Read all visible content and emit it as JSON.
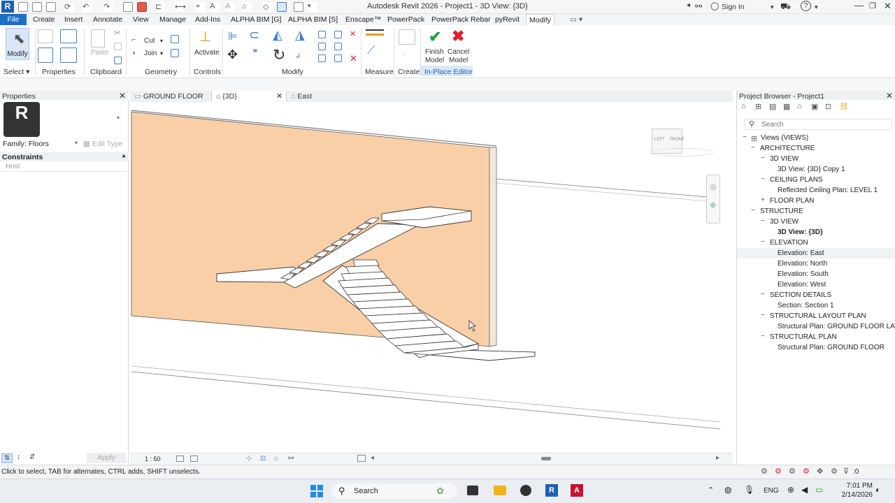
{
  "window": {
    "title": "Autodesk Revit 2026 - Project1 - 3D View: {3D}",
    "sign_in": "Sign In",
    "help": "?"
  },
  "menubar": {
    "items": [
      "File",
      "Create",
      "Insert",
      "Annotate",
      "View",
      "Manage",
      "Add-Ins",
      "ALPHA BIM [G]",
      "ALPHA BIM [S]",
      "Enscape™",
      "PowerPack",
      "PowerPack Rebar",
      "pyRevit",
      "Modify"
    ]
  },
  "ribbon": {
    "modify_label": "Modify",
    "cut_label": "Cut",
    "join_label": "Join",
    "paste_label": "Paste",
    "activate_label": "Activate",
    "finish_model": [
      "Finish",
      "Model"
    ],
    "cancel_model": [
      "Cancel",
      "Model"
    ],
    "groups": [
      "Select",
      "Properties",
      "Clipboard",
      "Geometry",
      "Controls",
      "Modify",
      "Measure",
      "Create",
      "In-Place Editor"
    ]
  },
  "properties": {
    "title": "Properties",
    "family": "Family: Floors",
    "edit_type": "Edit Type",
    "constraints": "Constraints",
    "host": "Host",
    "apply": "Apply",
    "logo_letter": "R"
  },
  "tabs": [
    "GROUND FLOOR",
    "{3D}",
    "East"
  ],
  "viewcube": {
    "left": "LEFT",
    "front": "FRONT"
  },
  "view_controls": {
    "scale": "1 : 50"
  },
  "project_browser": {
    "title": "Project Browser - Project1",
    "search_placeholder": "Search",
    "tree": [
      {
        "text": "Views (VIEWS)",
        "level": 0,
        "toggle": "−"
      },
      {
        "text": "ARCHITECTURE",
        "level": 1,
        "toggle": "−"
      },
      {
        "text": "3D VIEW",
        "level": 2,
        "toggle": "−"
      },
      {
        "text": "3D View: {3D} Copy 1",
        "level": 3,
        "toggle": ""
      },
      {
        "text": "CEILING PLANS",
        "level": 2,
        "toggle": "−"
      },
      {
        "text": "Reflected Ceiling Plan: LEVEL 1",
        "level": 3,
        "toggle": ""
      },
      {
        "text": "FLOOR PLAN",
        "level": 2,
        "toggle": "+"
      },
      {
        "text": "STRUCTURE",
        "level": 1,
        "toggle": "−"
      },
      {
        "text": "3D VIEW",
        "level": 2,
        "toggle": "−"
      },
      {
        "text": "3D View: {3D}",
        "level": 3,
        "toggle": "",
        "bold": true
      },
      {
        "text": "ELEVATION",
        "level": 2,
        "toggle": "−"
      },
      {
        "text": "Elevation: East",
        "level": 3,
        "toggle": "",
        "highlight": true
      },
      {
        "text": "Elevation: North",
        "level": 3,
        "toggle": ""
      },
      {
        "text": "Elevation: South",
        "level": 3,
        "toggle": ""
      },
      {
        "text": "Elevation: West",
        "level": 3,
        "toggle": ""
      },
      {
        "text": "SECTION DETAILS",
        "level": 2,
        "toggle": "−"
      },
      {
        "text": "Section: Section 1",
        "level": 3,
        "toggle": ""
      },
      {
        "text": "STRUCTURAL LAYOUT PLAN",
        "level": 2,
        "toggle": "−"
      },
      {
        "text": "Structural Plan: GROUND FLOOR LAYOUT",
        "level": 3,
        "toggle": ""
      },
      {
        "text": "STRUCTURAL PLAN",
        "level": 2,
        "toggle": "−"
      },
      {
        "text": "Structural Plan: GROUND FLOOR",
        "level": 3,
        "toggle": ""
      }
    ]
  },
  "status": {
    "hint": "Click to select, TAB for alternates, CTRL adds, SHIFT unselects.",
    "filter_count": ":0"
  },
  "taskbar": {
    "search": "Search",
    "lang": "ENG",
    "time": "7:01 PM",
    "date": "2/14/2026"
  },
  "colors": {
    "accent": "#1f6fc5",
    "wall": "#f9cfa8",
    "finish_green": "#22a33a",
    "cancel_red": "#d9232b"
  }
}
